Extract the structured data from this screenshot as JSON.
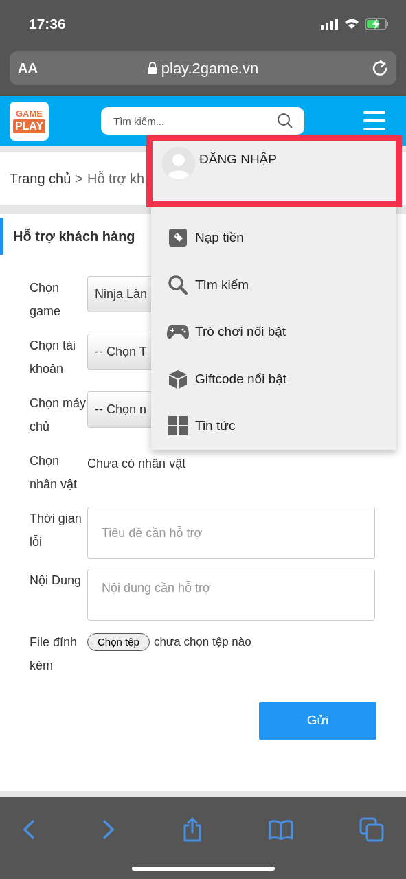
{
  "status_bar": {
    "time": "17:36"
  },
  "browser": {
    "text_size": "AA",
    "url": "play.2game.vn"
  },
  "header": {
    "logo_top": "GAME",
    "logo_bottom": "PLAY",
    "search": {
      "placeholder": "Tìm kiếm..."
    }
  },
  "breadcrumb": [
    "Trang chủ",
    ">",
    "Hỗ trợ kh"
  ],
  "page_title": "Hỗ trợ khách hàng",
  "form": [
    {
      "kind": "select",
      "label": "Chọn game",
      "value": "Ninja Làn"
    },
    {
      "kind": "select",
      "label": "Chọn tài khoản",
      "value": "-- Chọn T"
    },
    {
      "kind": "select",
      "label": "Chọn máy chủ",
      "value": "-- Chọn n"
    },
    {
      "kind": "text",
      "label": "Chọn nhân vật",
      "value": "Chưa có nhân vật"
    },
    {
      "kind": "input",
      "label": "Thời gian lỗi",
      "placeholder": "Tiêu đề cần hỗ trợ"
    },
    {
      "kind": "textarea",
      "label": "Nội Dung",
      "placeholder": "Nội dung cần hỗ trợ"
    },
    {
      "kind": "file",
      "label": "File đính kèm",
      "button": "Chọn tệp",
      "status": "chưa chọn tệp nào"
    }
  ],
  "submit": "Gửi",
  "menu": {
    "login": "ĐĂNG NHẬP",
    "items": [
      {
        "label": "Nạp tiền"
      },
      {
        "label": "Tìm kiếm"
      },
      {
        "label": "Trò chơi nổi bật"
      },
      {
        "label": "Giftcode nổi bật"
      },
      {
        "label": "Tin tức"
      }
    ]
  }
}
